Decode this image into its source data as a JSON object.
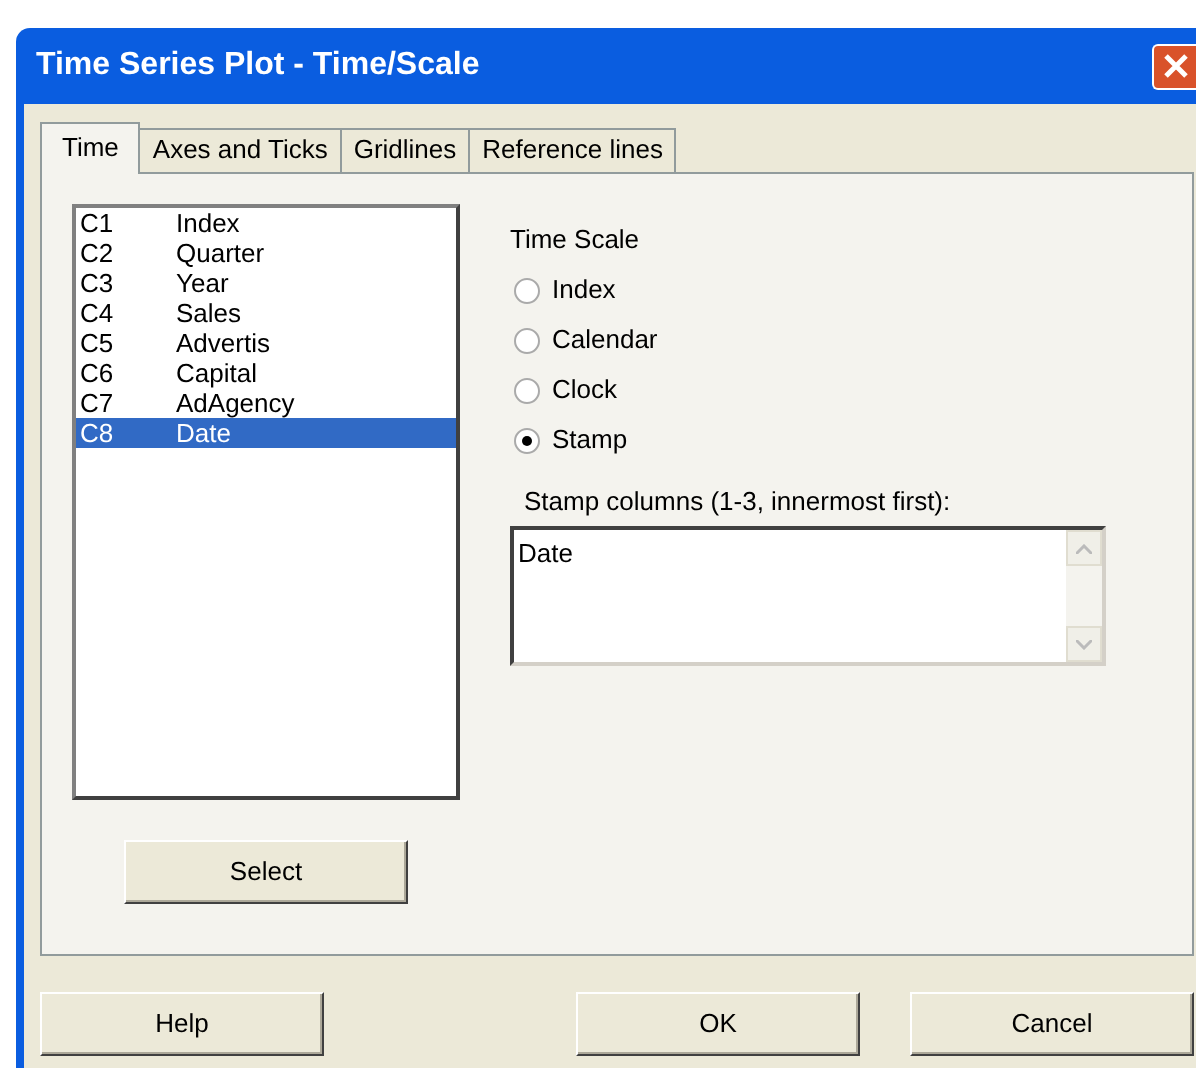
{
  "window": {
    "title": "Time Series Plot - Time/Scale"
  },
  "tabs": [
    {
      "label": "Time",
      "selected": true
    },
    {
      "label": "Axes and Ticks",
      "selected": false
    },
    {
      "label": "Gridlines",
      "selected": false
    },
    {
      "label": "Reference lines",
      "selected": false
    }
  ],
  "columns": [
    {
      "id": "C1",
      "name": "Index",
      "selected": false
    },
    {
      "id": "C2",
      "name": "Quarter",
      "selected": false
    },
    {
      "id": "C3",
      "name": "Year",
      "selected": false
    },
    {
      "id": "C4",
      "name": "Sales",
      "selected": false
    },
    {
      "id": "C5",
      "name": "Advertis",
      "selected": false
    },
    {
      "id": "C6",
      "name": "Capital",
      "selected": false
    },
    {
      "id": "C7",
      "name": "AdAgency",
      "selected": false
    },
    {
      "id": "C8",
      "name": "Date",
      "selected": true
    }
  ],
  "select_button": "Select",
  "time_scale": {
    "label": "Time Scale",
    "options": [
      {
        "label": "Index",
        "selected": false
      },
      {
        "label": "Calendar",
        "selected": false
      },
      {
        "label": "Clock",
        "selected": false
      },
      {
        "label": "Stamp",
        "selected": true
      }
    ]
  },
  "stamp_columns": {
    "label": "Stamp columns (1-3, innermost first):",
    "value": "Date"
  },
  "buttons": [
    "Help",
    "OK",
    "Cancel"
  ]
}
